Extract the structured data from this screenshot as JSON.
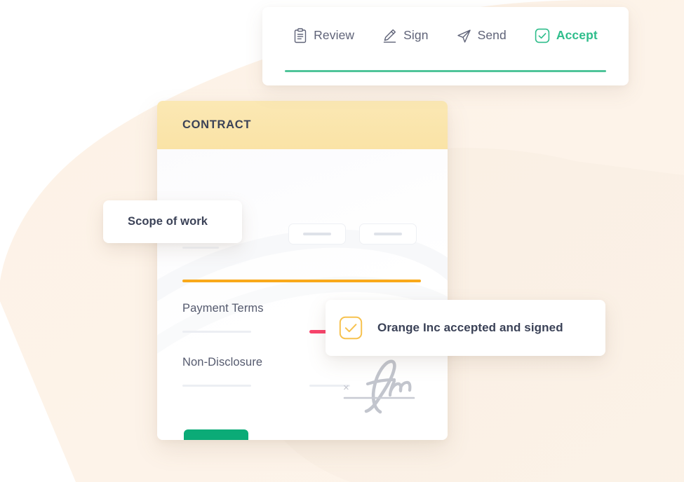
{
  "background": {
    "page_color": "#ffffff",
    "blob_color": "#fdf1e4",
    "blob_color_light": "#fcf3e8"
  },
  "toolbar": {
    "steps": [
      {
        "label": "Review",
        "icon": "clipboard-icon",
        "active": false
      },
      {
        "label": "Sign",
        "icon": "pencil-icon",
        "active": false
      },
      {
        "label": "Send",
        "icon": "paper-plane-icon",
        "active": false
      },
      {
        "label": "Accept",
        "icon": "checkbox-check-icon",
        "active": true
      }
    ],
    "progress_color": "#4fc49a",
    "inactive_color": "#5f6378",
    "active_color": "#2ebd8b"
  },
  "contract": {
    "header_title": "CONTRACT",
    "header_bg": "#fae3a6",
    "title_color": "#3b4257",
    "accent_blue": "#2b9cf5",
    "accent_orange": "#f9a91b",
    "accent_pink": "#f9436b",
    "fields": [
      {
        "label": "Payment Terms"
      },
      {
        "label": "Non-Disclosure"
      }
    ],
    "submit_button": {
      "icon": "submit-dash-icon",
      "color": "#0bab77"
    },
    "signature": {
      "icon": "handwritten-signature-icon",
      "mark": "×"
    },
    "placeholder_boxes": [
      {
        "icon": "dash-placeholder-icon"
      },
      {
        "icon": "dash-placeholder-icon"
      }
    ]
  },
  "chips": {
    "scope": {
      "label": "Scope of work"
    },
    "accepted": {
      "label": "Orange Inc accepted and signed",
      "icon": "checkbox-check-icon",
      "icon_color": "#f7c24f"
    }
  }
}
